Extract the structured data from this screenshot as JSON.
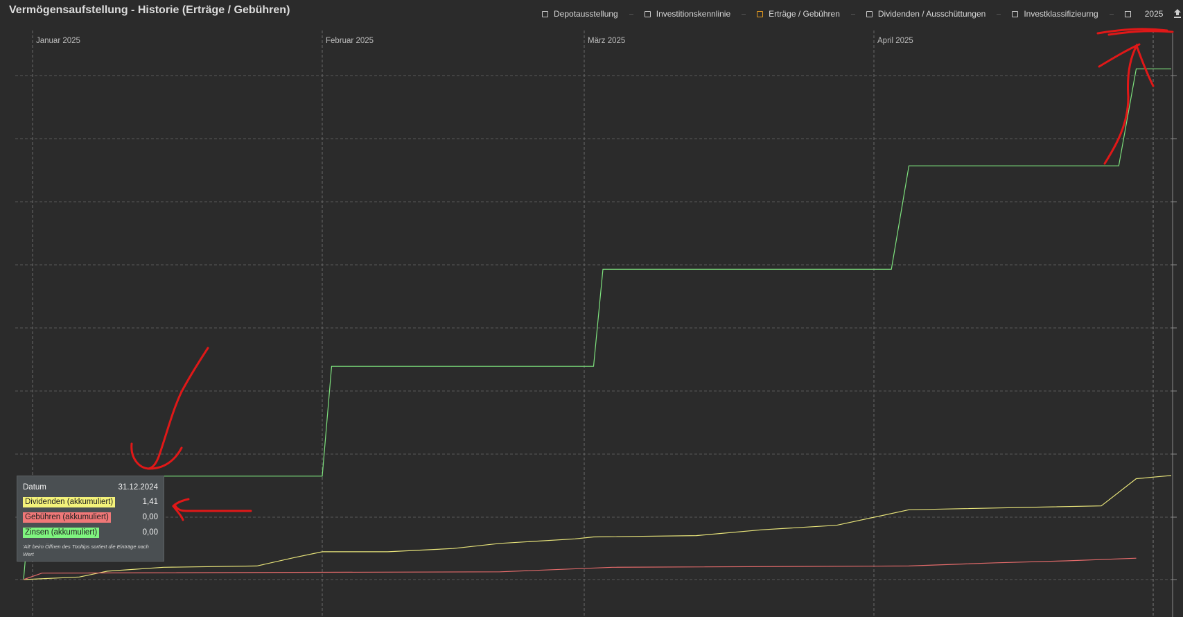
{
  "header": {
    "title": "Vermögensaufstellung - Historie (Erträge / Gebühren)"
  },
  "toolbar": {
    "items": [
      {
        "label": "Depotausstellung",
        "active": false
      },
      {
        "label": "Investitionskennlinie",
        "active": false
      },
      {
        "label": "Erträge / Gebühren",
        "active": true
      },
      {
        "label": "Dividenden / Ausschüttungen",
        "active": false
      },
      {
        "label": "Investklassifizieurng",
        "active": false
      }
    ],
    "year": "2025",
    "accent_color": "#e59b1f"
  },
  "tooltip": {
    "date_label": "Datum",
    "date_value": "31.12.2024",
    "rows": [
      {
        "label": "Dividenden (akkumuliert)",
        "value": "1,41",
        "color": "#f4f27a"
      },
      {
        "label": "Gebühren (akkumuliert)",
        "value": "0,00",
        "color": "#f07878"
      },
      {
        "label": "Zinsen (akkumuliert)",
        "value": "0,00",
        "color": "#7ff57f"
      }
    ],
    "note": "'Alt' beim Öffnen des Tooltips sortiert die Einträge nach Wert"
  },
  "chart_data": {
    "type": "line",
    "x_labels": [
      "Januar 2025",
      "Februar 2025",
      "März 2025",
      "April 2025"
    ],
    "x_range": [
      "2024-12-31",
      "2025-04-16"
    ],
    "y_axis_labels_shown": false,
    "grid": true,
    "series": [
      {
        "name": "Zinsen (akkumuliert)",
        "color": "#7ee37e",
        "step": true,
        "points": [
          [
            "2024-12-31",
            0
          ],
          [
            "2025-01-01",
            16
          ],
          [
            "2025-02-01",
            16
          ],
          [
            "2025-02-02",
            33
          ],
          [
            "2025-03-02",
            33
          ],
          [
            "2025-03-03",
            48
          ],
          [
            "2025-04-02",
            48
          ],
          [
            "2025-04-03",
            64
          ],
          [
            "2025-04-15",
            64
          ],
          [
            "2025-04-16",
            79
          ],
          [
            "2025-04-18",
            79
          ]
        ]
      },
      {
        "name": "Dividenden (akkumuliert)",
        "color": "#e8e47a",
        "step": true,
        "points": [
          [
            "2024-12-31",
            0
          ],
          [
            "2025-01-06",
            0.4
          ],
          [
            "2025-01-09",
            1.3
          ],
          [
            "2025-01-15",
            1.9
          ],
          [
            "2025-01-25",
            2.1
          ],
          [
            "2025-01-29",
            3.4
          ],
          [
            "2025-02-01",
            4.3
          ],
          [
            "2025-02-08",
            4.3
          ],
          [
            "2025-02-15",
            4.8
          ],
          [
            "2025-02-20",
            5.6
          ],
          [
            "2025-02-28",
            6.3
          ],
          [
            "2025-03-02",
            6.6
          ],
          [
            "2025-03-13",
            6.8
          ],
          [
            "2025-03-20",
            7.7
          ],
          [
            "2025-03-28",
            8.4
          ],
          [
            "2025-04-03",
            10.8
          ],
          [
            "2025-04-14",
            11.4
          ],
          [
            "2025-04-16",
            15.6
          ],
          [
            "2025-04-18",
            16.1
          ]
        ]
      },
      {
        "name": "Gebühren (akkumuliert)",
        "color": "#e26a6a",
        "step": true,
        "points": [
          [
            "2024-12-31",
            0
          ],
          [
            "2025-01-02",
            1.0
          ],
          [
            "2025-02-20",
            1.2
          ],
          [
            "2025-03-04",
            1.9
          ],
          [
            "2025-04-03",
            2.1
          ],
          [
            "2025-04-08",
            2.6
          ],
          [
            "2025-04-12",
            2.9
          ],
          [
            "2025-04-16",
            3.3
          ]
        ]
      }
    ]
  }
}
